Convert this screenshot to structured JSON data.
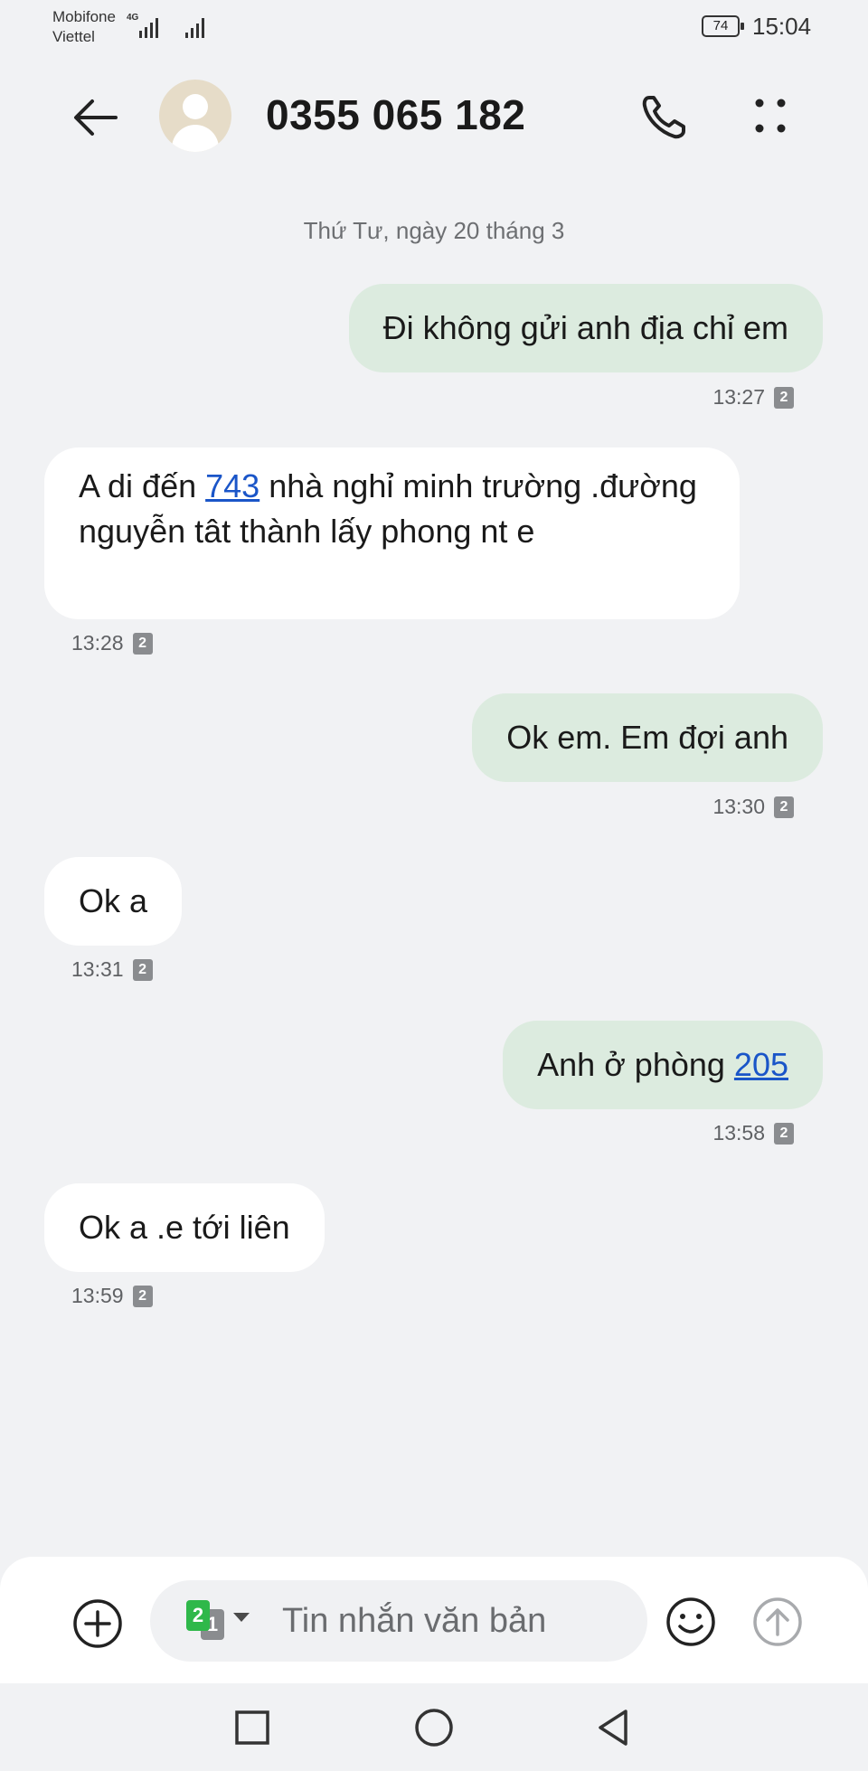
{
  "status_bar": {
    "carrier_1": "Mobifone",
    "carrier_2": "Viettel",
    "network": "4G",
    "battery": "74",
    "time": "15:04"
  },
  "header": {
    "contact": "0355 065 182",
    "icons": {
      "back": "arrow-left-icon",
      "avatar": "person-avatar",
      "call": "phone-icon",
      "more": "more-dots-icon"
    }
  },
  "conversation": {
    "date_separator": "Thứ Tư, ngày 20 tháng 3",
    "messages": [
      {
        "direction": "outgoing",
        "text": "Đi không gửi anh địa chỉ em",
        "time": "13:27",
        "sim": "2"
      },
      {
        "direction": "incoming",
        "text_before": "A di đến ",
        "link": "743",
        "text_after": " nhà nghỉ minh trường .đường nguyễn tât thành lấy phong nt e",
        "time": "13:28",
        "sim": "2"
      },
      {
        "direction": "outgoing",
        "text": "Ok em. Em đợi anh",
        "time": "13:30",
        "sim": "2"
      },
      {
        "direction": "incoming",
        "text": "Ok a",
        "time": "13:31",
        "sim": "2"
      },
      {
        "direction": "outgoing",
        "text_before": "Anh ở phòng ",
        "link": "205",
        "time": "13:58",
        "sim": "2"
      },
      {
        "direction": "incoming",
        "text": "Ok a .e tới liên",
        "time": "13:59",
        "sim": "2"
      }
    ]
  },
  "composer": {
    "placeholder": "Tin nhắn văn bản",
    "sim_primary": "2",
    "sim_secondary": "1",
    "icons": {
      "add": "plus-circle-icon",
      "emoji": "smiley-icon",
      "send": "send-arrow-icon"
    }
  },
  "colors": {
    "outgoing_bubble": "#dcebdf",
    "incoming_bubble": "#ffffff",
    "link": "#1a55c8",
    "background": "#f1f2f4",
    "sim_active": "#2fb84a"
  }
}
